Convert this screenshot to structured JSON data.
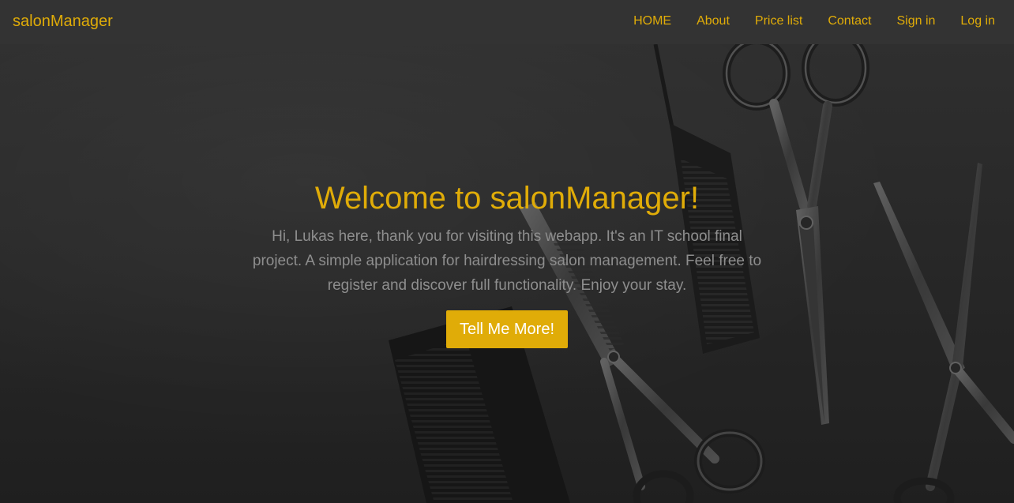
{
  "navbar": {
    "brand": "salonManager",
    "links": [
      "HOME",
      "About",
      "Price list",
      "Contact",
      "Sign in",
      "Log in"
    ]
  },
  "hero": {
    "title": "Welcome to salonManager!",
    "subtitle": "Hi, Lukas here, thank you for visiting this webapp. It's an IT school final project. A simple application for hairdressing salon management. Feel free to register and discover full functionality. Enjoy your stay.",
    "cta_label": "Tell Me More!",
    "background_image": "scissors-and-combs-icon"
  },
  "colors": {
    "accent": "#e0ac08",
    "navbar_bg": "#333333",
    "hero_bg": "#2b2b2b",
    "subtitle_text": "#8e8e8e"
  }
}
